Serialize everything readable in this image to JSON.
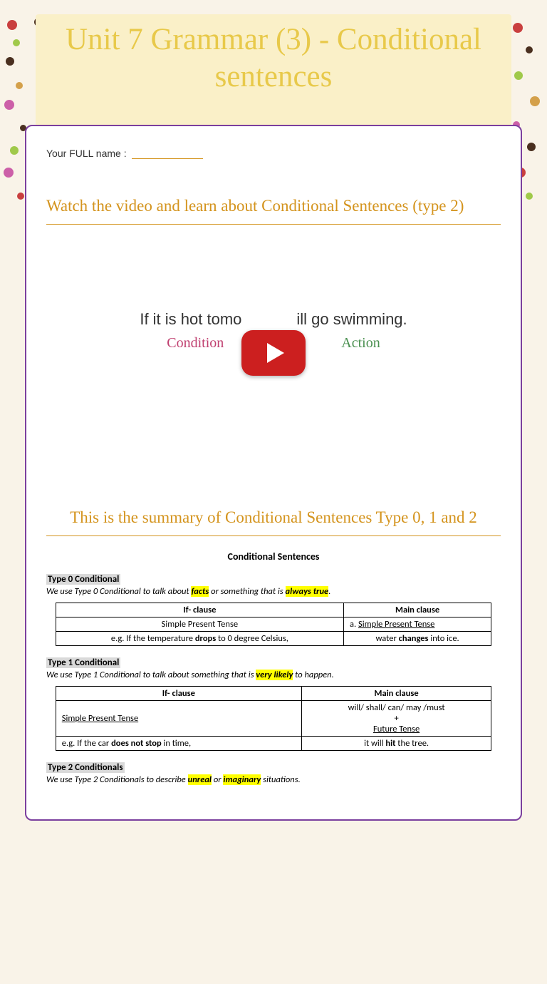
{
  "title": "Unit 7 Grammar (3) - Conditional sentences",
  "name_label": "Your FULL name :",
  "section1_title": "Watch the video and learn about Conditional Sentences (type 2)",
  "video": {
    "sentence_left": "If it is hot tomo",
    "sentence_right": "ill go swimming.",
    "label_condition": "Condition",
    "label_action": "Action"
  },
  "section2_title": "This is the summary of Conditional Sentences Type 0, 1 and 2",
  "summary": {
    "heading": "Conditional Sentences",
    "type0": {
      "header": "Type 0 Conditional",
      "desc_pre": "We use Type 0 Conditional to talk about ",
      "desc_hl1": "facts",
      "desc_mid": " or something that is ",
      "desc_hl2": "always true",
      "desc_post": ".",
      "if_label": "If- clause",
      "main_label": "Main clause",
      "if_tense": "Simple Present Tense",
      "main_tense_prefix": "a.   ",
      "main_tense": "Simple Present Tense",
      "if_eg_pre": "e.g. If the temperature ",
      "if_eg_bold": "drops",
      "if_eg_post": " to 0 degree Celsius,",
      "main_eg_pre": "water ",
      "main_eg_bold": "changes",
      "main_eg_post": " into ice."
    },
    "type1": {
      "header": "Type 1 Conditional",
      "desc_pre": "We use Type 1 Conditional to talk about something that is ",
      "desc_hl": "very likely",
      "desc_post": " to happen.",
      "if_label": "If- clause",
      "main_label": "Main clause",
      "if_tense": "Simple Present Tense",
      "main_l1": "will/ shall/ can/ may /must",
      "main_l2": "+",
      "main_l3": "Future Tense",
      "if_eg_pre": "e.g.  If the car ",
      "if_eg_bold": "does not stop",
      "if_eg_post": " in time,",
      "main_eg_pre": "it will ",
      "main_eg_bold": "hit",
      "main_eg_post": " the tree."
    },
    "type2": {
      "header": "Type 2 Conditionals",
      "desc_pre": "We use Type 2 Conditionals to describe ",
      "desc_hl1": "unreal",
      "desc_mid": " or ",
      "desc_hl2": "imaginary",
      "desc_post": " situations."
    }
  },
  "dots": [
    {
      "t": 8,
      "l": 10,
      "s": 14,
      "c": "#c93f3f"
    },
    {
      "t": 35,
      "l": 18,
      "s": 10,
      "c": "#a0c94a"
    },
    {
      "t": 60,
      "l": 8,
      "s": 12,
      "c": "#4a2f1f"
    },
    {
      "t": 95,
      "l": 22,
      "s": 10,
      "c": "#d4a04a"
    },
    {
      "t": 120,
      "l": 6,
      "s": 14,
      "c": "#cc5fa8"
    },
    {
      "t": 155,
      "l": 28,
      "s": 9,
      "c": "#4a2f1f"
    },
    {
      "t": 185,
      "l": 14,
      "s": 12,
      "c": "#a0c94a"
    },
    {
      "t": 215,
      "l": 5,
      "s": 14,
      "c": "#cc5fa8"
    },
    {
      "t": 250,
      "l": 24,
      "s": 10,
      "c": "#c93f3f"
    },
    {
      "t": 5,
      "l": 48,
      "s": 12,
      "c": "#4a2f1f"
    },
    {
      "t": 12,
      "l": 720,
      "s": 14,
      "c": "#c93f3f"
    },
    {
      "t": 45,
      "l": 738,
      "s": 10,
      "c": "#4a2f1f"
    },
    {
      "t": 80,
      "l": 722,
      "s": 12,
      "c": "#a0c94a"
    },
    {
      "t": 115,
      "l": 744,
      "s": 14,
      "c": "#d4a04a"
    },
    {
      "t": 150,
      "l": 720,
      "s": 10,
      "c": "#cc5fa8"
    },
    {
      "t": 180,
      "l": 740,
      "s": 12,
      "c": "#4a2f1f"
    },
    {
      "t": 215,
      "l": 724,
      "s": 14,
      "c": "#c93f3f"
    },
    {
      "t": 250,
      "l": 738,
      "s": 10,
      "c": "#a0c94a"
    },
    {
      "t": 10,
      "l": 700,
      "s": 10,
      "c": "#cc5fa8"
    }
  ]
}
